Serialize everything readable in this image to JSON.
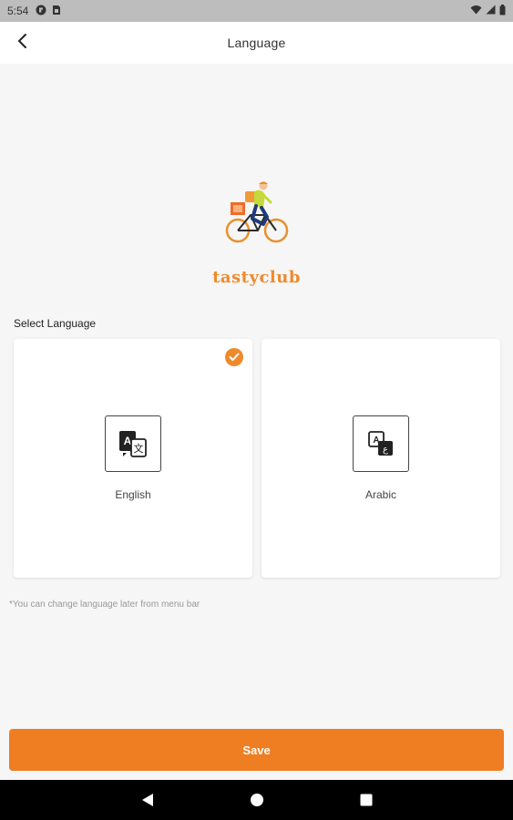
{
  "status_bar": {
    "time": "5:54",
    "icons": [
      "app-badge-icon",
      "sim-card-icon",
      "wifi-icon",
      "signal-icon",
      "battery-icon"
    ]
  },
  "app_bar": {
    "title": "Language",
    "back_icon": "chevron-left-icon"
  },
  "brand": {
    "name": "tastyclub",
    "logo": "delivery-cyclist-logo",
    "color": "#ef8a2c"
  },
  "language_section": {
    "label": "Select Language",
    "options": [
      {
        "label": "English",
        "icon": "translate-icon",
        "selected": true
      },
      {
        "label": "Arabic",
        "icon": "translate-alt-icon",
        "selected": false
      }
    ],
    "note": "*You can change language later from menu bar"
  },
  "save_button": {
    "label": "Save",
    "color": "#ef7d22"
  },
  "nav_bar": {
    "buttons": [
      "back-triangle-icon",
      "home-circle-icon",
      "recents-square-icon"
    ]
  }
}
